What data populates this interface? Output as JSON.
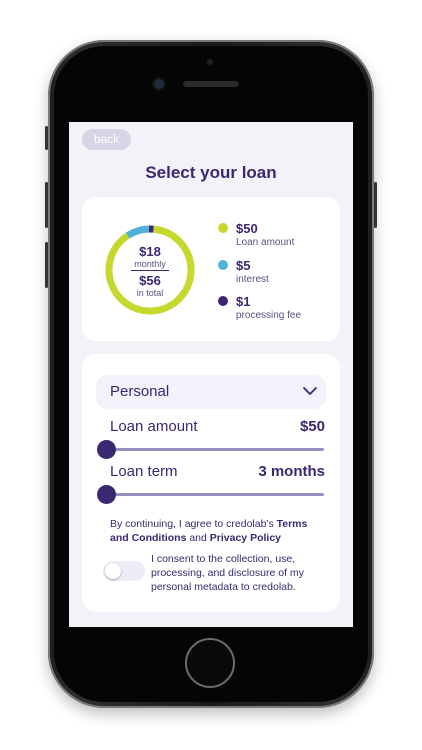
{
  "colors": {
    "primary": "#3b2870",
    "loan_amount": "#c4d82d",
    "interest": "#4fb3d9",
    "processing_fee": "#3b2870"
  },
  "header": {
    "back_label": "back",
    "title": "Select your loan"
  },
  "summary": {
    "monthly_amount": "$18",
    "monthly_label": "monthly",
    "total_amount": "$56",
    "total_label": "in total",
    "breakdown": [
      {
        "value": "$50",
        "label": "Loan amount",
        "amount": 50,
        "color": "#c4d82d"
      },
      {
        "value": "$5",
        "label": "interest",
        "amount": 5,
        "color": "#4fb3d9"
      },
      {
        "value": "$1",
        "label": "processing fee",
        "amount": 1,
        "color": "#3b2870"
      }
    ]
  },
  "form": {
    "loan_type": "Personal",
    "loan_amount_label": "Loan amount",
    "loan_amount_value": "$50",
    "loan_amount_fraction": 0,
    "loan_term_label": "Loan term",
    "loan_term_value": "3 months",
    "loan_term_fraction": 0,
    "terms_prefix": "By continuing, I agree to credolab's ",
    "terms_link": "Terms and Conditions",
    "terms_and": " and ",
    "privacy_link": "Privacy Policy",
    "consent_text": "I consent to the collection, use, processing, and disclosure of my personal metadata to credolab.",
    "consent_on": false
  }
}
